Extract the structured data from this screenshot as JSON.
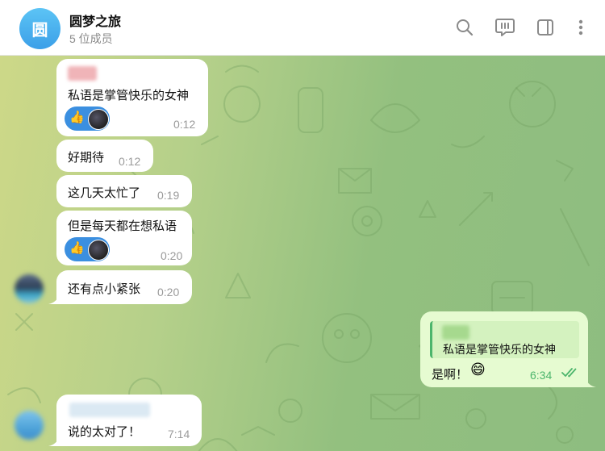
{
  "header": {
    "avatar_letter": "圆",
    "title": "圆梦之旅",
    "subtitle": "5 位成员",
    "icons": [
      "search-icon",
      "chat-channel-icon",
      "sidebar-toggle-icon",
      "more-vertical-icon"
    ]
  },
  "messages": [
    {
      "text": "私语是掌管快乐的女神",
      "time": "0:12",
      "reaction_emoji": "👍"
    },
    {
      "text": "好期待",
      "time": "0:12"
    },
    {
      "text": "这几天太忙了",
      "time": "0:19"
    },
    {
      "text": "但是每天都在想私语",
      "time": "0:20",
      "reaction_emoji": "👍"
    },
    {
      "text": "还有点小紧张",
      "time": "0:20"
    },
    {
      "text": "说的太对了！",
      "time": "7:14"
    }
  ],
  "outgoing": {
    "reply_text": "私语是掌管快乐的女神",
    "text": "是啊！",
    "emoji": "😄",
    "time": "6:34",
    "status": "✓✓"
  },
  "colors": {
    "accent": "#3b8fe0",
    "outgoing_bubble": "#e6fbd1",
    "check_green": "#4cb56c"
  }
}
